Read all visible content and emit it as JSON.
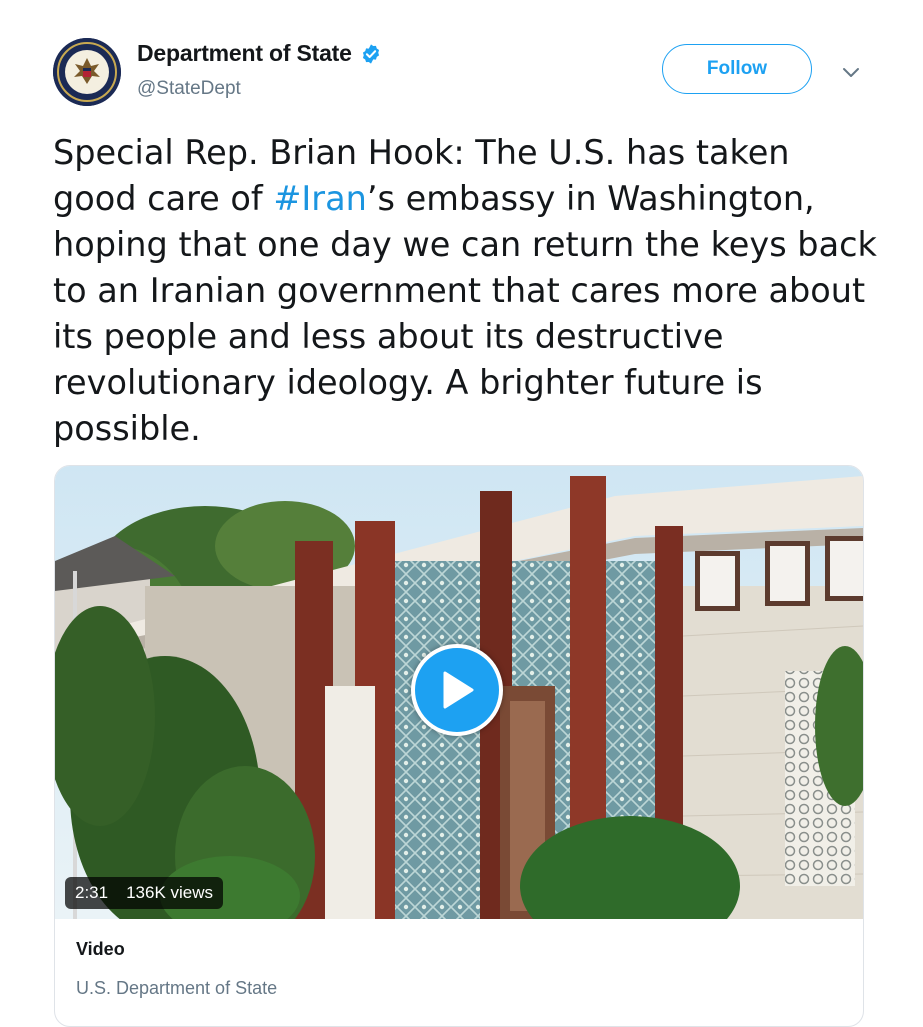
{
  "account": {
    "name": "Department of State",
    "handle": "@StateDept",
    "verified": true
  },
  "follow_label": "Follow",
  "tweet": {
    "text_before": "Special Rep. Brian Hook: The U.S. has taken good care of ",
    "hashtag": "#Iran",
    "text_after": "’s embassy in Washington, hoping that one day we can return the keys back to an Iranian government that cares more about its people and less about its destructive revolutionary ideology. A brighter future is possible."
  },
  "video": {
    "duration": "2:31",
    "views": "136K views"
  },
  "card": {
    "title": "Video",
    "source": "U.S. Department of State"
  },
  "colors": {
    "accent": "#1da1f2",
    "hashtag": "#1b95e0",
    "secondary_text": "#657786"
  },
  "icons": [
    "avatar-seal",
    "verified-badge-icon",
    "chevron-down-icon",
    "play-icon"
  ]
}
